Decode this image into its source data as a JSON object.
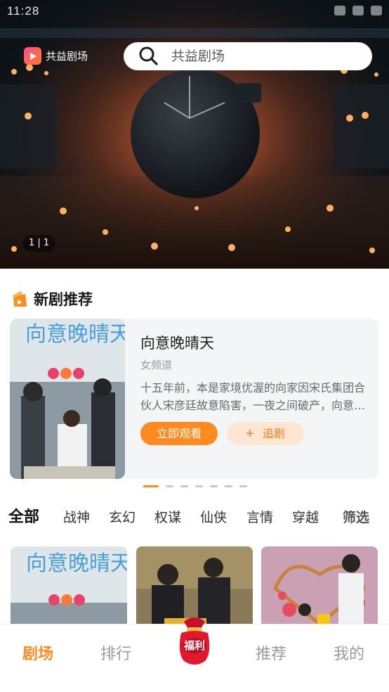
{
  "status_bar": {
    "time": "11:28"
  },
  "header": {
    "brand_name": "共益剧场",
    "search_placeholder": "共益剧场"
  },
  "banner": {
    "counter": "1 | 1"
  },
  "section": {
    "title": "新剧推荐"
  },
  "featured": {
    "title": "向意晚晴天",
    "channel": "女频道",
    "description": "十五年前，本是家境优渥的向家因宋氏集团合伙人宋彦廷故意陷害，一夜之间破产，向意母亲跳楼身亡……",
    "poster_title": "向意晚晴天",
    "watch_label": "立即观看",
    "follow_label": "追剧",
    "follow_icon": "plus-icon"
  },
  "carousel": {
    "count": 8,
    "active_index": 0
  },
  "tabs": {
    "items": [
      "全部",
      "战神",
      "玄幻",
      "权谋",
      "仙侠",
      "言情",
      "穿越"
    ],
    "active": "全部",
    "filter_label": "筛选"
  },
  "grid": {
    "items": [
      {
        "poster_title": "向意晚晴天"
      },
      {
        "poster_title": ""
      },
      {
        "poster_title": ""
      }
    ]
  },
  "bottom_nav": {
    "items": [
      "剧场",
      "排行",
      "推荐",
      "我的"
    ],
    "active": "剧场",
    "welfare_label": "福利"
  },
  "colors": {
    "accent": "#ff8a1f",
    "accent_light": "#ffe6d2",
    "card_bg": "#f4f5f7"
  }
}
